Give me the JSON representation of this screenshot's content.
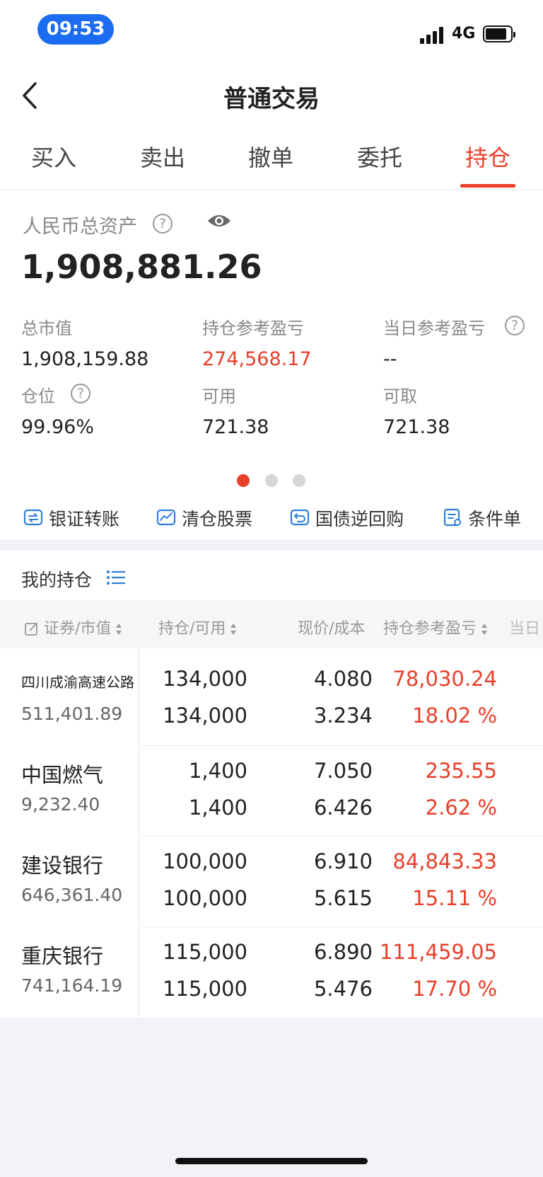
{
  "status_bar": {
    "time": "09:53",
    "network": "4G",
    "battery_level": 0.85
  },
  "nav": {
    "title": "普通交易"
  },
  "tabs": [
    {
      "label": "买入"
    },
    {
      "label": "卖出"
    },
    {
      "label": "撤单"
    },
    {
      "label": "委托"
    },
    {
      "label": "持仓",
      "active": true
    }
  ],
  "assets": {
    "total_label": "人民币总资产",
    "total_value": "1,908,881.26",
    "stats": [
      {
        "label": "总市值",
        "value": "1,908,159.88"
      },
      {
        "label": "持仓参考盈亏",
        "value": "274,568.17",
        "color": "#e8402a"
      },
      {
        "label": "当日参考盈亏",
        "value": "--"
      },
      {
        "label": "仓位",
        "value": "99.96%"
      },
      {
        "label": "可用",
        "value": "721.38"
      },
      {
        "label": "可取",
        "value": "721.38"
      }
    ],
    "page_dots": {
      "count": 3,
      "active": 1
    }
  },
  "quick_actions": [
    {
      "label": "银证转账",
      "icon": "bank-transfer-icon"
    },
    {
      "label": "清仓股票",
      "icon": "clear-stock-icon"
    },
    {
      "label": "国债逆回购",
      "icon": "repo-icon"
    },
    {
      "label": "条件单",
      "icon": "conditional-order-icon"
    }
  ],
  "holdings": {
    "title": "我的持仓",
    "columns": {
      "security": "证券/市值",
      "position": "持仓/可用",
      "price": "现价/成本",
      "pnl": "持仓参考盈亏",
      "truncated": "当日"
    },
    "rows": [
      {
        "name": "四川成渝高速公路",
        "market_value": "511,401.89",
        "position": "134,000",
        "available": "134,000",
        "price": "4.080",
        "cost": "3.234",
        "pnl": "78,030.24",
        "pnl_pct": "18.02 %"
      },
      {
        "name": "中国燃气",
        "market_value": "9,232.40",
        "position": "1,400",
        "available": "1,400",
        "price": "7.050",
        "cost": "6.426",
        "pnl": "235.55",
        "pnl_pct": "2.62 %"
      },
      {
        "name": "建设银行",
        "market_value": "646,361.40",
        "position": "100,000",
        "available": "100,000",
        "price": "6.910",
        "cost": "5.615",
        "pnl": "84,843.33",
        "pnl_pct": "15.11 %"
      },
      {
        "name": "重庆银行",
        "market_value": "741,164.19",
        "position": "115,000",
        "available": "115,000",
        "price": "6.890",
        "cost": "5.476",
        "pnl": "111,459.05",
        "pnl_pct": "17.70 %"
      }
    ]
  },
  "colors": {
    "accent": "#e8402a",
    "icon_blue": "#2f7fd8",
    "time_pill": "#1b6cf2"
  }
}
